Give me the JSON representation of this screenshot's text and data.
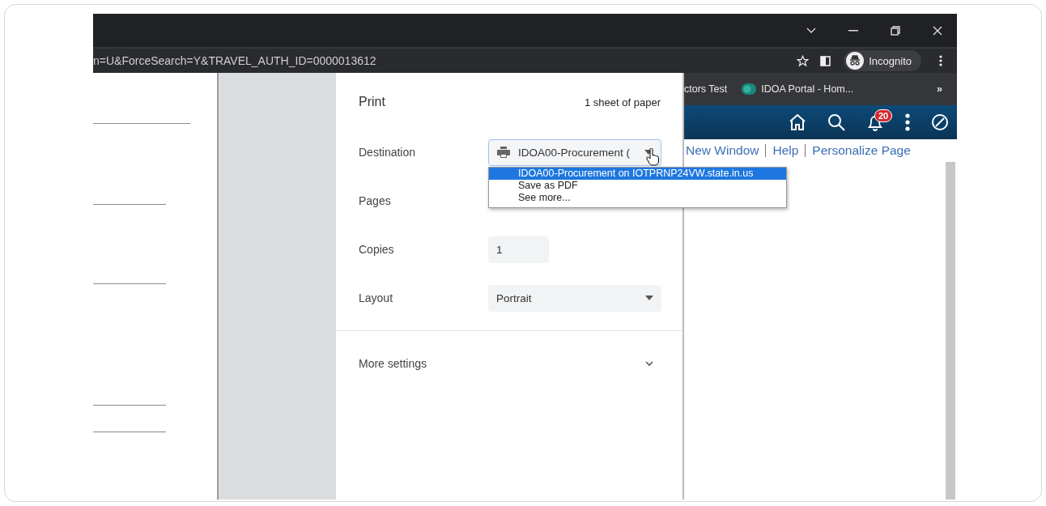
{
  "address_bar": {
    "url": "n=U&ForceSearch=Y&TRAVEL_AUTH_ID=0000013612",
    "profile_label": "Incognito"
  },
  "bookmarks": {
    "items": [
      {
        "label": "ctors Test",
        "kind": "text"
      },
      {
        "label": "IDOA Portal - Hom...",
        "kind": "site"
      }
    ],
    "overflow": "»"
  },
  "site_header": {
    "notification_count": "20"
  },
  "site_links": [
    "New Window",
    "Help",
    "Personalize Page"
  ],
  "print_dialog": {
    "title": "Print",
    "sheet_count": "1 sheet of paper",
    "settings": [
      {
        "label": "Destination",
        "kind": "printer-select",
        "value": "IDOA00-Procurement (",
        "focused": true
      },
      {
        "label": "Pages",
        "kind": "covered"
      },
      {
        "label": "Copies",
        "kind": "number",
        "value": "1"
      },
      {
        "label": "Layout",
        "kind": "select",
        "value": "Portrait"
      }
    ],
    "more_settings": {
      "label": "More settings",
      "expanded": false
    },
    "destination_options": [
      {
        "label": "IDOA00-Procurement on IOTPRNP24VW.state.in.us",
        "selected": true
      },
      {
        "label": "Save as PDF",
        "selected": false
      },
      {
        "label": "See more...",
        "selected": false
      }
    ]
  }
}
